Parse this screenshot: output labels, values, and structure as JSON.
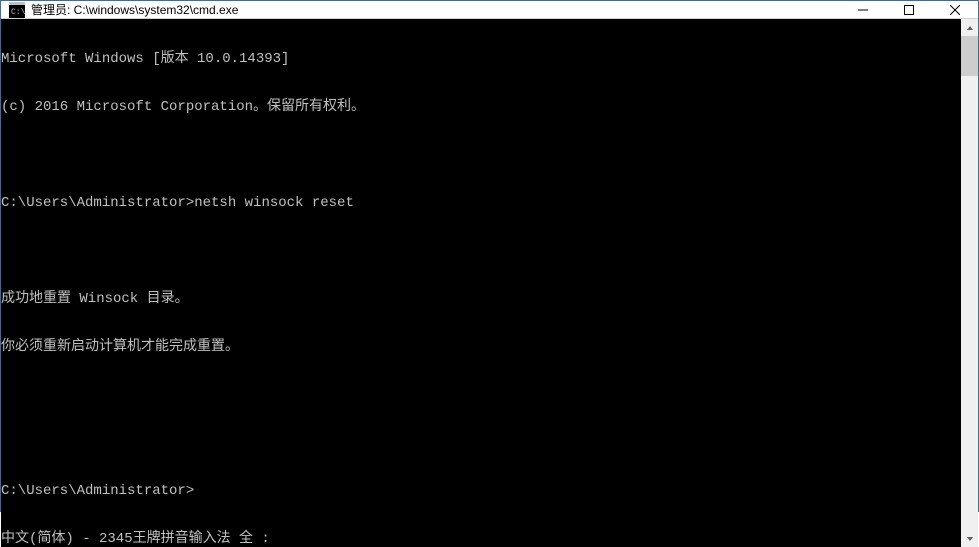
{
  "window": {
    "title": "管理员: C:\\windows\\system32\\cmd.exe"
  },
  "terminal": {
    "lines": [
      "Microsoft Windows [版本 10.0.14393]",
      "(c) 2016 Microsoft Corporation。保留所有权利。",
      "",
      "C:\\Users\\Administrator>netsh winsock reset",
      "",
      "成功地重置 Winsock 目录。",
      "你必须重新启动计算机才能完成重置。",
      "",
      "",
      "C:\\Users\\Administrator>"
    ],
    "ime_status": "中文(简体) - 2345王牌拼音输入法 全 :"
  }
}
